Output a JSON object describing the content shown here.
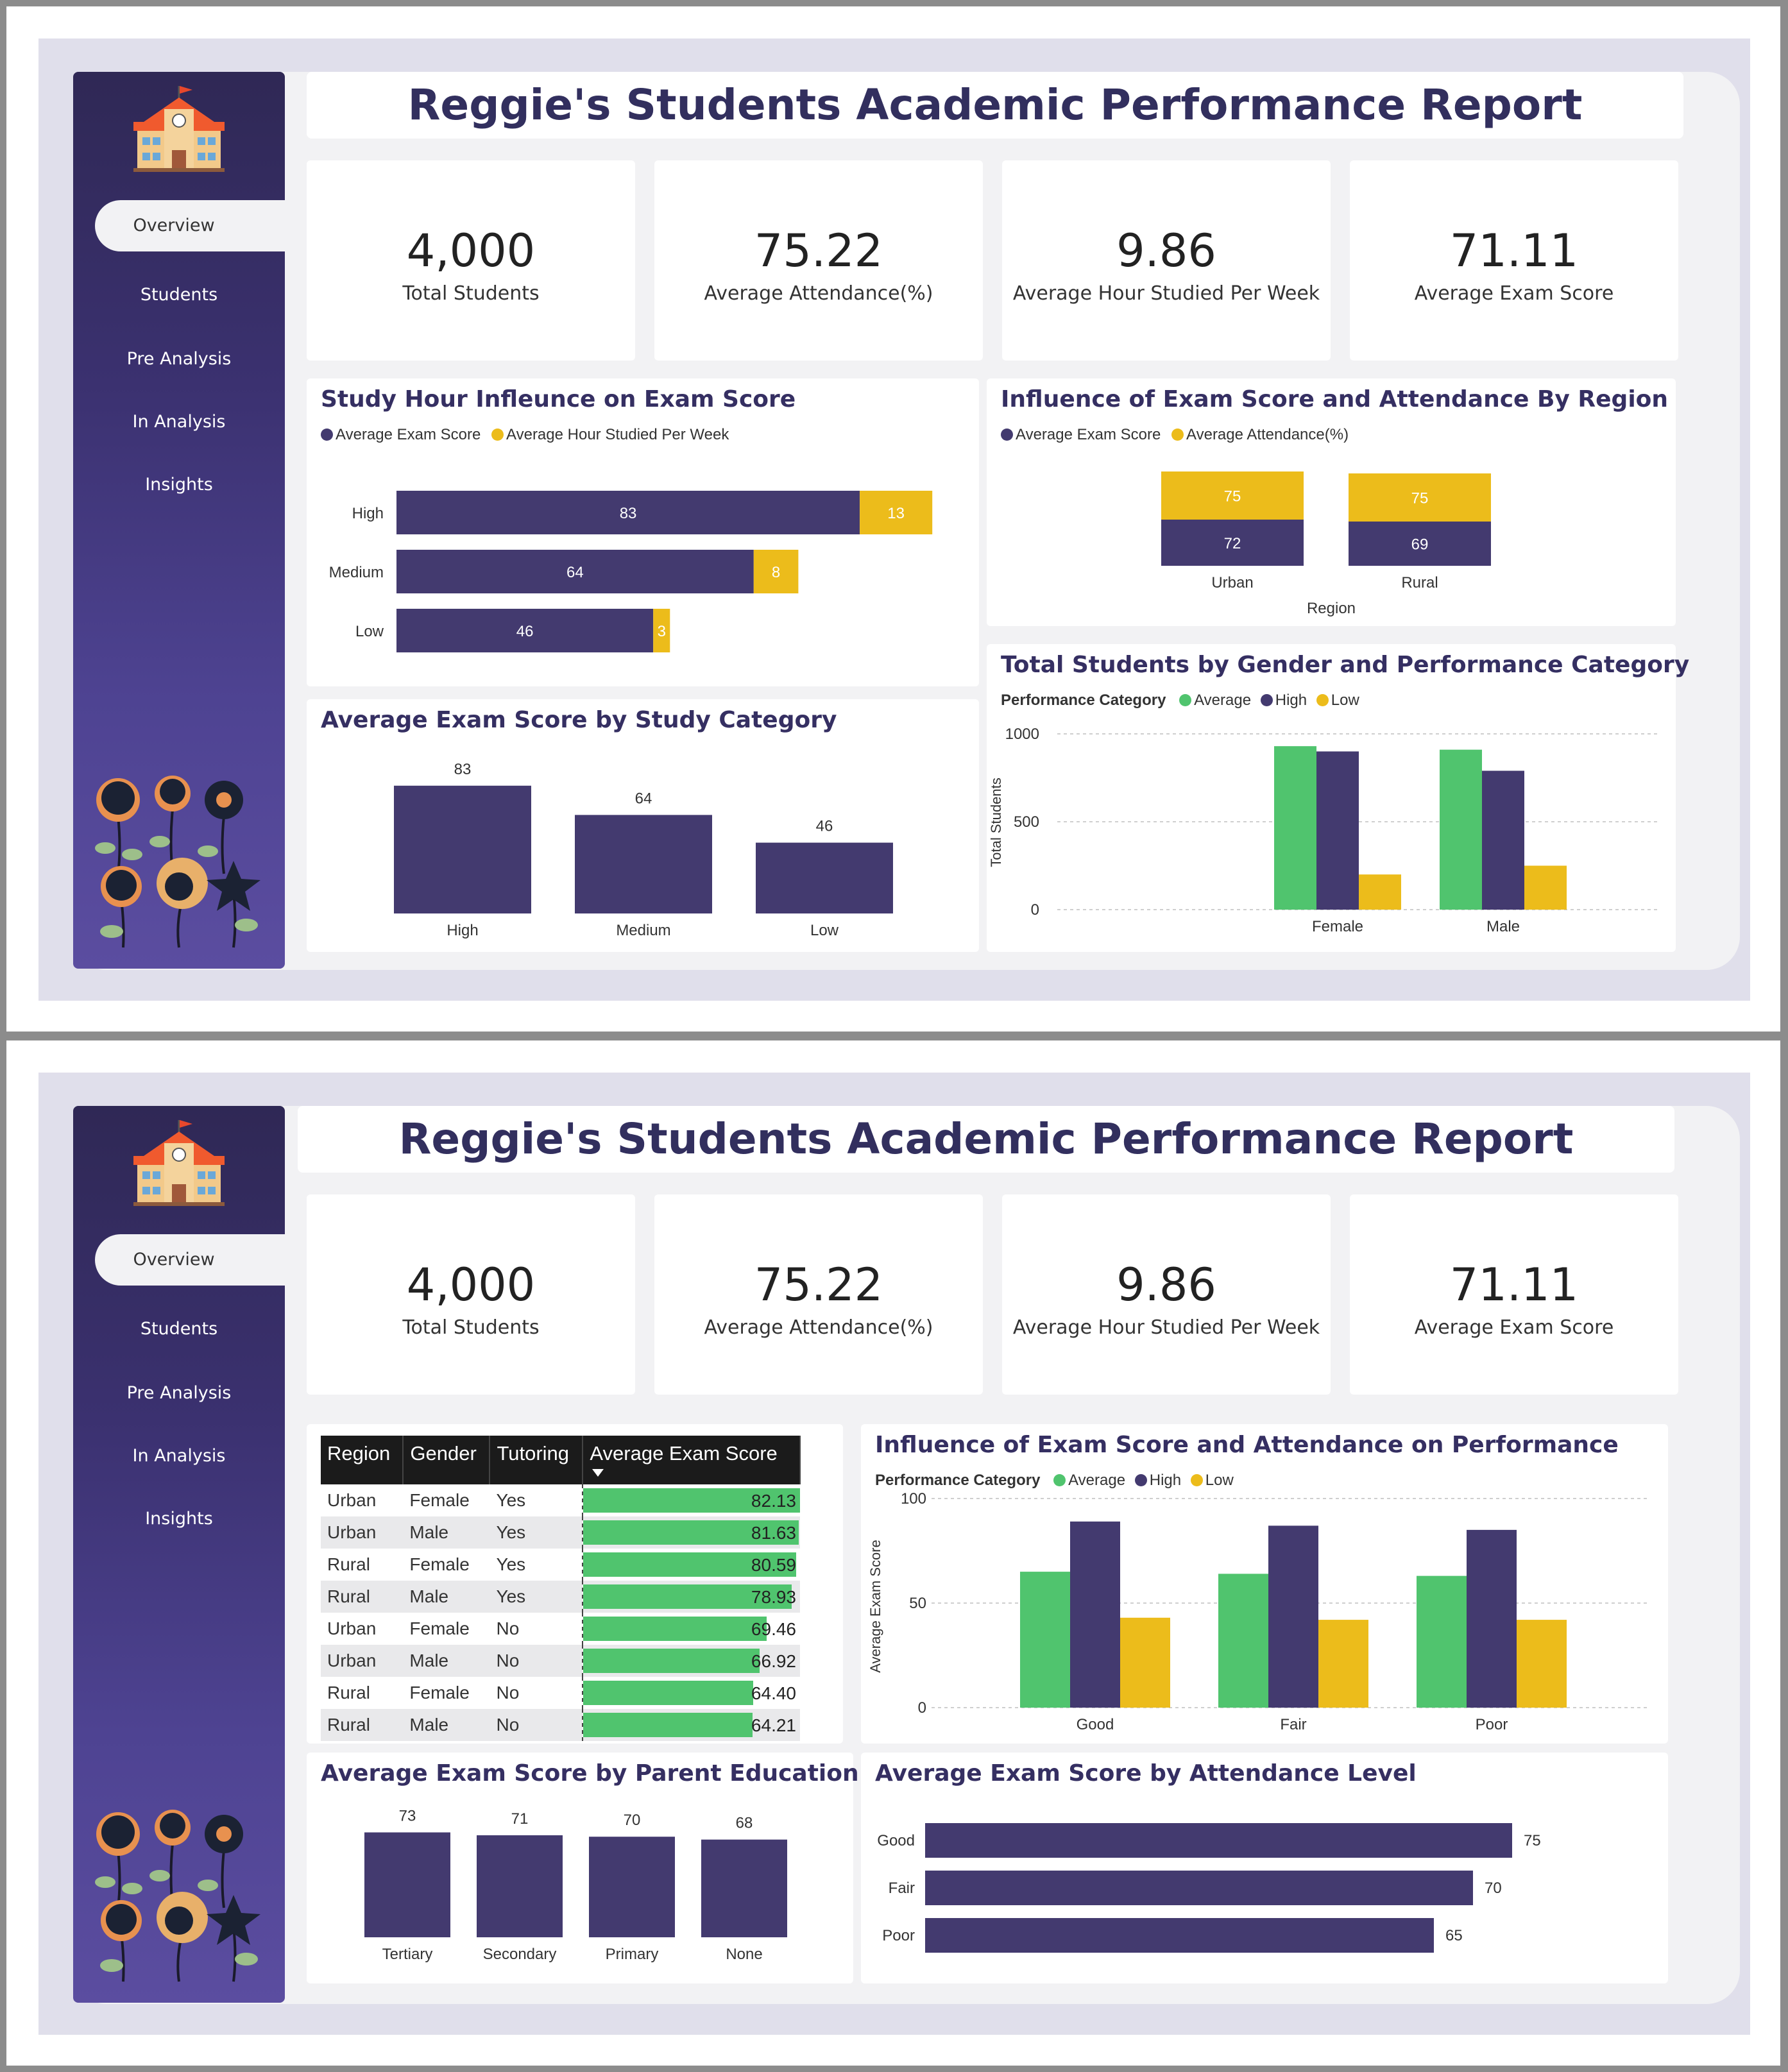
{
  "report_title": "Reggie's Students Academic Performance Report",
  "nav": [
    {
      "label": "Overview",
      "active": true
    },
    {
      "label": "Students",
      "active": false
    },
    {
      "label": "Pre Analysis",
      "active": false
    },
    {
      "label": "In Analysis",
      "active": false
    },
    {
      "label": "Insights",
      "active": false
    }
  ],
  "kpis": [
    {
      "value": "4,000",
      "label": "Total Students"
    },
    {
      "value": "75.22",
      "label": "Average Attendance(%)"
    },
    {
      "value": "9.86",
      "label": "Average Hour Studied Per Week"
    },
    {
      "value": "71.11",
      "label": "Average Exam Score"
    }
  ],
  "colors": {
    "purple": "#433a6f",
    "gold": "#ecbc1b",
    "green": "#50c46e",
    "title": "#322f5e"
  },
  "icons": {
    "school": "school-building-icon",
    "flowers": "flower-illustration-icon",
    "sort": "sort-descending-icon"
  },
  "page1": {
    "study_hour": {
      "title": "Study Hour Infleunce on Exam Score",
      "legend": [
        "Average Exam Score",
        "Average Hour Studied Per Week"
      ],
      "chart_data": {
        "type": "bar",
        "orientation": "horizontal-stacked",
        "categories": [
          "High",
          "Medium",
          "Low"
        ],
        "series": [
          {
            "name": "Average Exam Score",
            "values": [
              83,
              64,
              46
            ]
          },
          {
            "name": "Average Hour Studied Per Week",
            "values": [
              13,
              8,
              3
            ]
          }
        ]
      }
    },
    "region": {
      "title": "Influence of Exam Score and Attendance By Region",
      "legend": [
        "Average Exam Score",
        "Average Attendance(%)"
      ],
      "chart_data": {
        "type": "bar",
        "orientation": "vertical-stacked",
        "categories": [
          "Urban",
          "Rural"
        ],
        "xlabel": "Region",
        "series": [
          {
            "name": "Average Exam Score",
            "values": [
              72,
              69
            ]
          },
          {
            "name": "Average Attendance(%)",
            "values": [
              75,
              75
            ]
          }
        ]
      }
    },
    "study_category": {
      "title": "Average Exam Score by Study Category",
      "chart_data": {
        "type": "bar",
        "categories": [
          "High",
          "Medium",
          "Low"
        ],
        "values": [
          83,
          64,
          46
        ]
      }
    },
    "gender_perf": {
      "title": "Total Students by Gender and Performance Category",
      "legend_title": "Performance Category",
      "legend": [
        "Average",
        "High",
        "Low"
      ],
      "chart_data": {
        "type": "bar",
        "categories": [
          "Female",
          "Male"
        ],
        "ylabel": "Total Students",
        "ylim": [
          0,
          1000
        ],
        "yticks": [
          "0",
          "500",
          "1000"
        ],
        "grid": true,
        "series": [
          {
            "name": "Average",
            "values": [
              930,
              910
            ]
          },
          {
            "name": "High",
            "values": [
              900,
              790
            ]
          },
          {
            "name": "Low",
            "values": [
              200,
              250
            ]
          }
        ]
      }
    }
  },
  "page2": {
    "table": {
      "headers": [
        "Region",
        "Gender",
        "Tutoring",
        "Average Exam Score"
      ],
      "rows": [
        [
          "Urban",
          "Female",
          "Yes",
          "82.13"
        ],
        [
          "Urban",
          "Male",
          "Yes",
          "81.63"
        ],
        [
          "Rural",
          "Female",
          "Yes",
          "80.59"
        ],
        [
          "Rural",
          "Male",
          "Yes",
          "78.93"
        ],
        [
          "Urban",
          "Female",
          "No",
          "69.46"
        ],
        [
          "Urban",
          "Male",
          "No",
          "66.92"
        ],
        [
          "Rural",
          "Female",
          "No",
          "64.40"
        ],
        [
          "Rural",
          "Male",
          "No",
          "64.21"
        ]
      ]
    },
    "performance": {
      "title": "Influence of Exam Score and Attendance on Performance",
      "legend_title": "Performance Category",
      "legend": [
        "Average",
        "High",
        "Low"
      ],
      "chart_data": {
        "type": "bar",
        "categories": [
          "Good",
          "Fair",
          "Poor"
        ],
        "ylabel": "Average Exam Score",
        "ylim": [
          0,
          100
        ],
        "yticks": [
          "0",
          "50",
          "100"
        ],
        "grid": true,
        "series": [
          {
            "name": "Average",
            "values": [
              65,
              64,
              63
            ]
          },
          {
            "name": "High",
            "values": [
              89,
              87,
              85
            ]
          },
          {
            "name": "Low",
            "values": [
              43,
              42,
              42
            ]
          }
        ]
      }
    },
    "parent_edu": {
      "title": "Average Exam Score by Parent Education",
      "chart_data": {
        "type": "bar",
        "categories": [
          "Tertiary",
          "Secondary",
          "Primary",
          "None"
        ],
        "values": [
          73,
          71,
          70,
          68
        ]
      }
    },
    "attendance_level": {
      "title": "Average Exam Score by Attendance Level",
      "chart_data": {
        "type": "bar",
        "orientation": "horizontal",
        "categories": [
          "Good",
          "Fair",
          "Poor"
        ],
        "values": [
          75,
          70,
          65
        ]
      }
    }
  }
}
